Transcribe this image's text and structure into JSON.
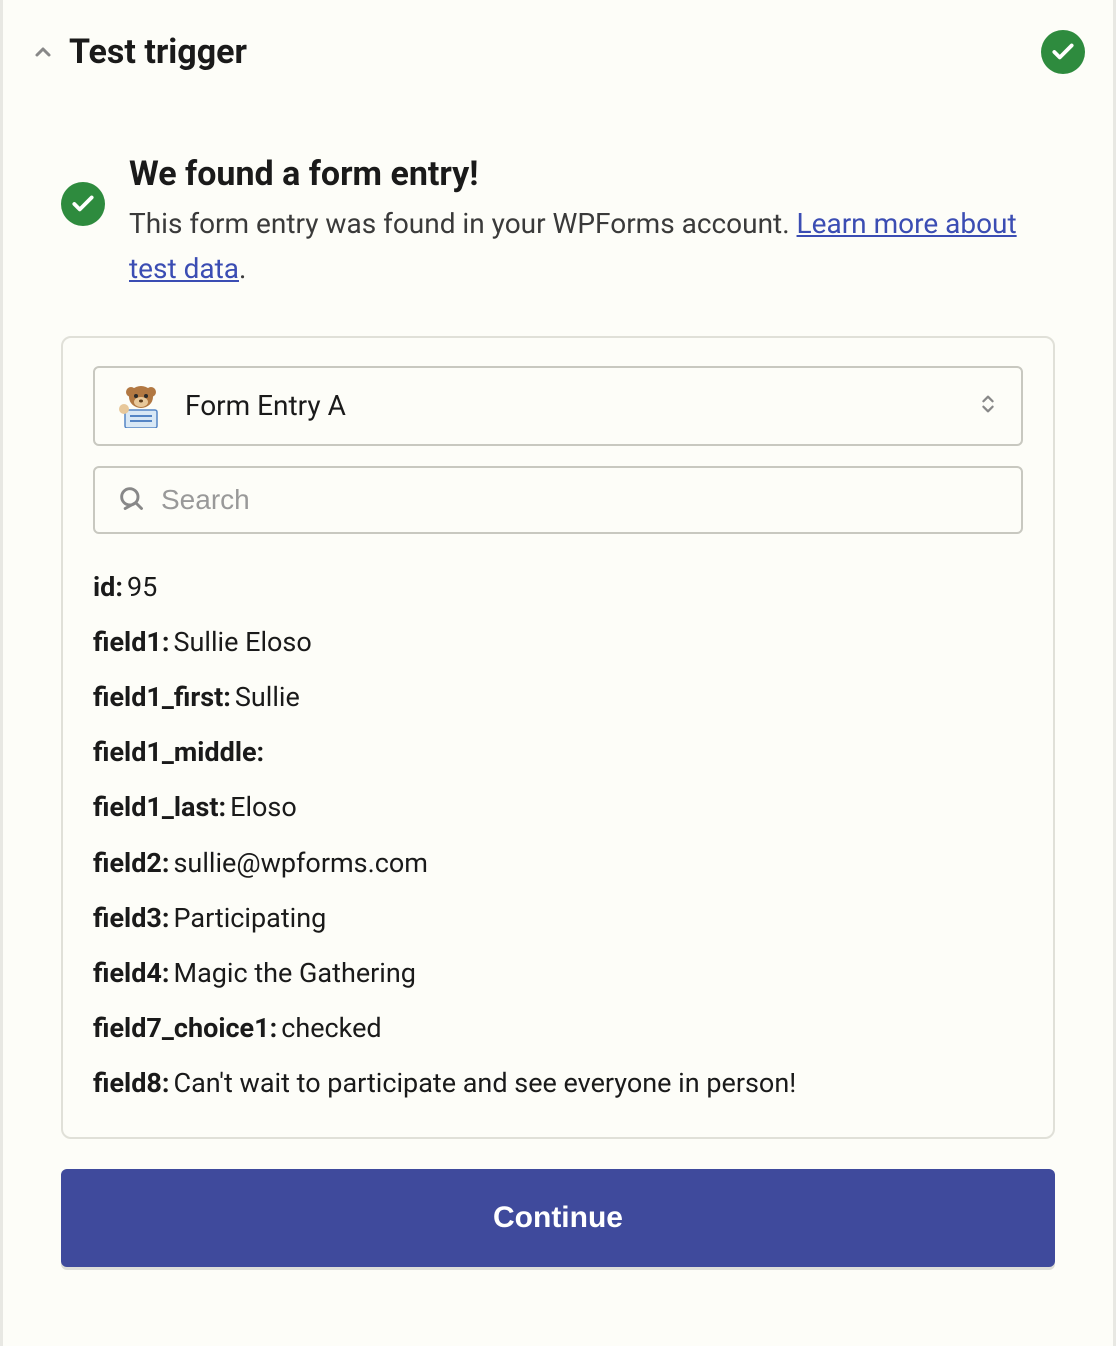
{
  "header": {
    "title": "Test trigger"
  },
  "found": {
    "heading": "We found a form entry!",
    "description_prefix": "This form entry was found in your WPForms account. ",
    "link_text": "Learn more about test data",
    "description_suffix": "."
  },
  "dropdown": {
    "selected": "Form Entry A"
  },
  "search": {
    "placeholder": "Search"
  },
  "fields": [
    {
      "key": "id:",
      "value": "95"
    },
    {
      "key": "field1:",
      "value": "Sullie Eloso"
    },
    {
      "key": "field1_first:",
      "value": "Sullie"
    },
    {
      "key": "field1_middle:",
      "value": ""
    },
    {
      "key": "field1_last:",
      "value": "Eloso"
    },
    {
      "key": "field2:",
      "value": "sullie@wpforms.com"
    },
    {
      "key": "field3:",
      "value": "Participating"
    },
    {
      "key": "field4:",
      "value": "Magic the Gathering"
    },
    {
      "key": "field7_choice1:",
      "value": "checked"
    },
    {
      "key": "field8:",
      "value": "Can't wait to participate and see everyone in person!"
    }
  ],
  "continue_label": "Continue"
}
